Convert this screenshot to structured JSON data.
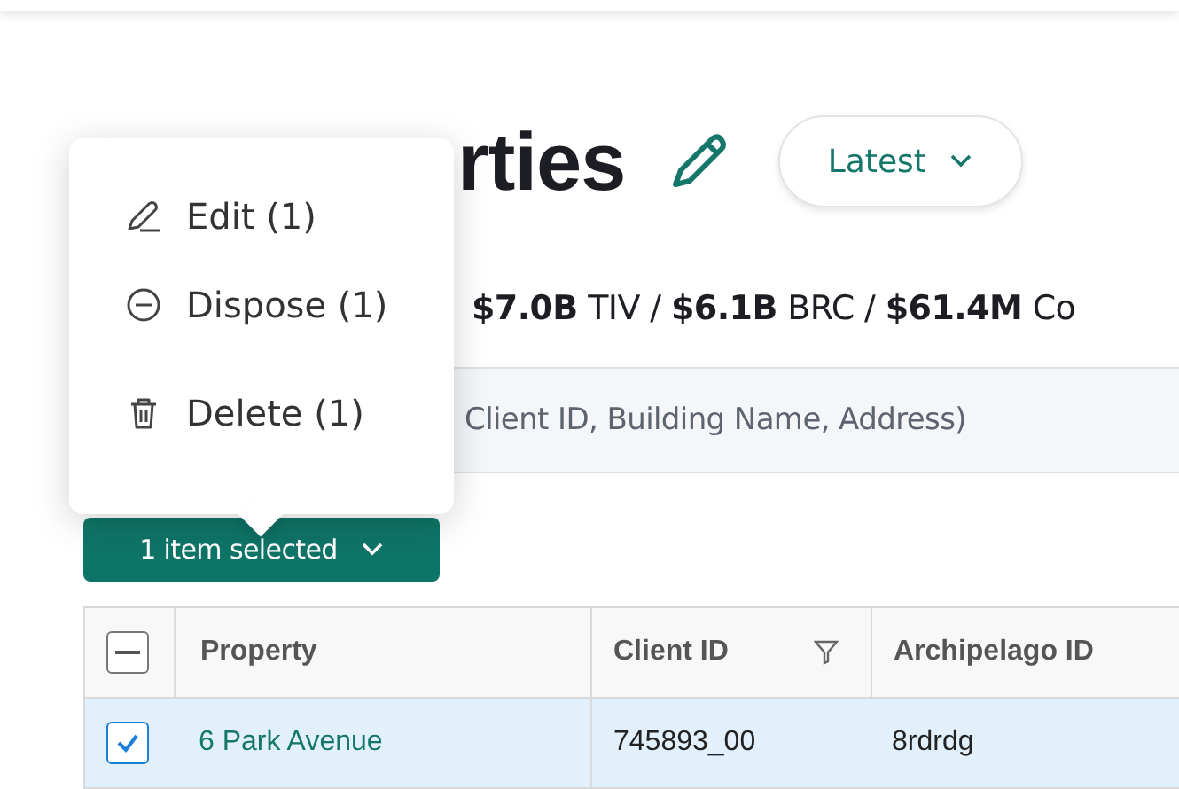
{
  "header": {
    "title": "rties",
    "sort_button": "Latest"
  },
  "stats": "**$7.0B** TIV / **$6.1B** BRC / **$61.4M** Co",
  "search": {
    "placeholder": "Client ID, Building Name, Address)"
  },
  "selection_button": "1 item selected",
  "menu": [
    {
      "kind": "edit",
      "label": "Edit (1)"
    },
    {
      "kind": "dispose",
      "label": "Dispose (1)"
    },
    {
      "kind": "delete",
      "label": "Delete (1)"
    }
  ],
  "table": {
    "select_all_partial": true,
    "columns": [
      {
        "label": "Property",
        "filter": false
      },
      {
        "label": "Client ID",
        "filter": true
      },
      {
        "label": "Archipelago ID",
        "filter": false
      }
    ],
    "rows": [
      {
        "selected": true,
        "cells": [
          "6 Park Avenue",
          "745893_00",
          "8rdrdg"
        ]
      }
    ]
  }
}
